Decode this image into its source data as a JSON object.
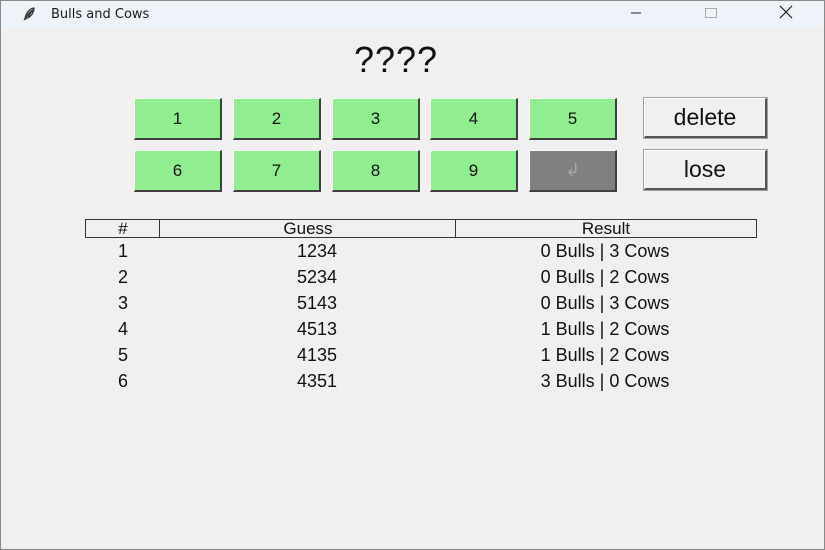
{
  "window": {
    "title": "Bulls and Cows",
    "icon": "feather-icon",
    "controls": [
      "minimize-icon",
      "maximize-icon",
      "close-icon"
    ]
  },
  "secret_display": "????",
  "keypad": {
    "color": "#90ee90",
    "disabled_color": "#808080",
    "keys": [
      "1",
      "2",
      "3",
      "4",
      "5",
      "6",
      "7",
      "8",
      "9"
    ],
    "enter_symbol": "↲"
  },
  "actions": {
    "delete_label": "delete",
    "lose_label": "lose"
  },
  "table": {
    "headers": [
      "#",
      "Guess",
      "Result"
    ],
    "rows": [
      {
        "num": "1",
        "guess": "1234",
        "result": "0 Bulls | 3 Cows"
      },
      {
        "num": "2",
        "guess": "5234",
        "result": "0 Bulls | 2 Cows"
      },
      {
        "num": "3",
        "guess": "5143",
        "result": "0 Bulls | 3 Cows"
      },
      {
        "num": "4",
        "guess": "4513",
        "result": "1 Bulls | 2 Cows"
      },
      {
        "num": "5",
        "guess": "4135",
        "result": "1 Bulls | 2 Cows"
      },
      {
        "num": "6",
        "guess": "4351",
        "result": "3 Bulls | 0 Cows"
      }
    ]
  }
}
